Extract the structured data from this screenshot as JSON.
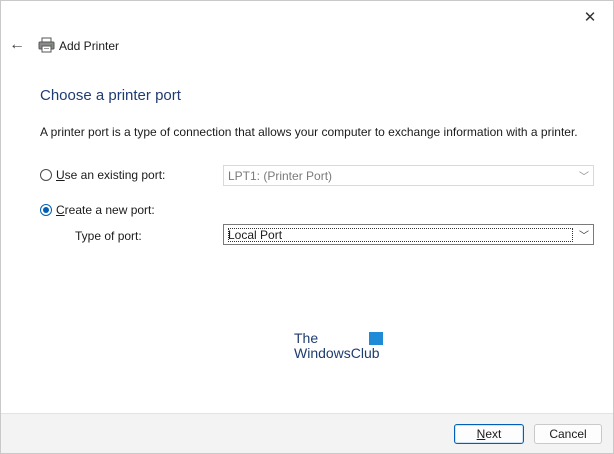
{
  "window": {
    "title": "Add Printer",
    "close_glyph": "✕",
    "back_glyph": "←"
  },
  "heading": "Choose a printer port",
  "description": "A printer port is a type of connection that allows your computer to exchange information with a printer.",
  "options": {
    "existing": {
      "label_accel": "U",
      "label_rest": "se an existing port:",
      "value": "LPT1: (Printer Port)",
      "selected": false
    },
    "new": {
      "label_accel": "C",
      "label_rest": "reate a new port:",
      "selected": true
    },
    "type_label": "Type of port:",
    "type_value": "Local Port"
  },
  "watermark": {
    "line1": "The",
    "line2": "WindowsClub"
  },
  "footer": {
    "next_accel": "N",
    "next_rest": "ext",
    "cancel": "Cancel"
  },
  "colors": {
    "accent": "#005fb8",
    "heading": "#1f3b73"
  }
}
